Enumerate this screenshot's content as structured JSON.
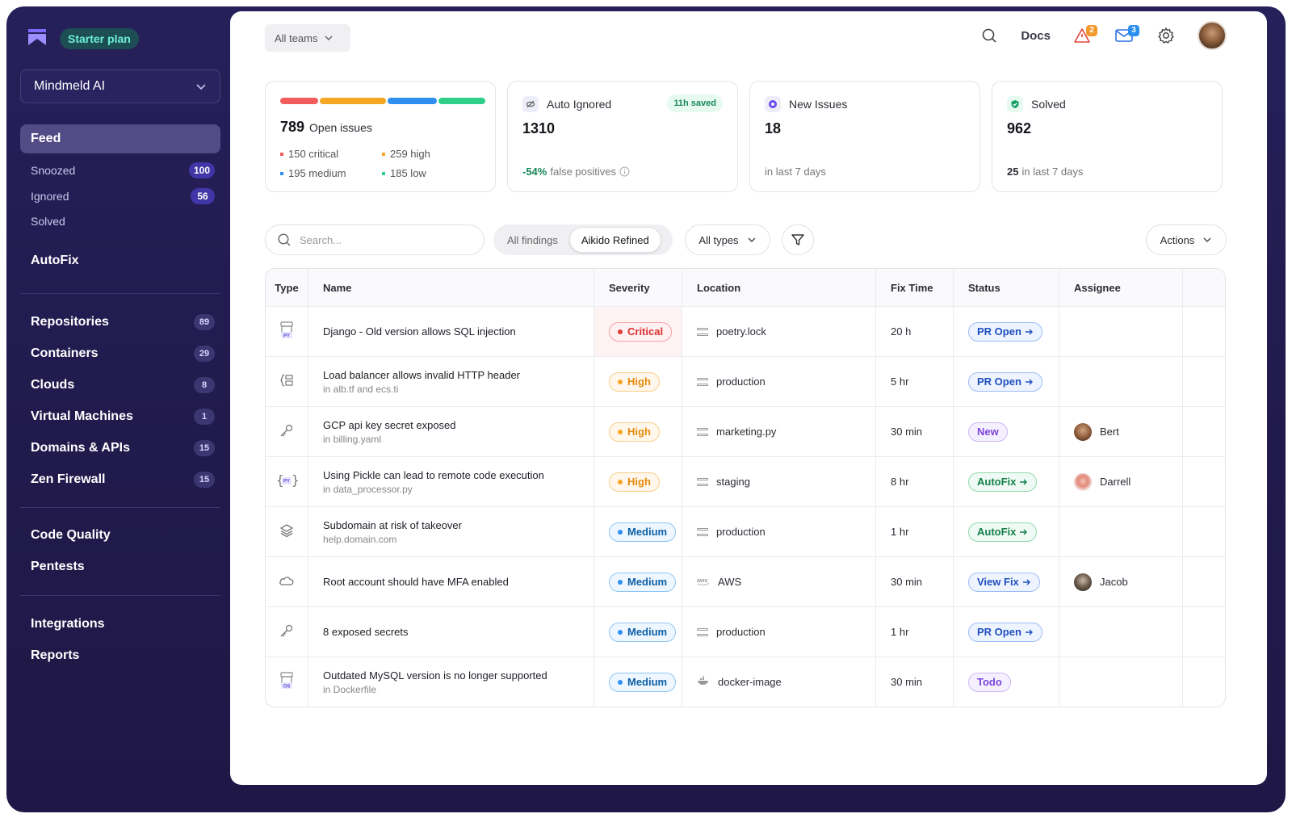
{
  "sidebar": {
    "plan_badge": "Starter plan",
    "org_name": "Mindmeld AI",
    "feed_label": "Feed",
    "sub_items": [
      {
        "label": "Snoozed",
        "count": "100"
      },
      {
        "label": "Ignored",
        "count": "56"
      },
      {
        "label": "Solved",
        "count": ""
      }
    ],
    "autofix_label": "AutoFix",
    "groups": [
      {
        "label": "Repositories",
        "count": "89"
      },
      {
        "label": "Containers",
        "count": "29"
      },
      {
        "label": "Clouds",
        "count": "8"
      },
      {
        "label": "Virtual Machines",
        "count": "1"
      },
      {
        "label": "Domains & APIs",
        "count": "15"
      },
      {
        "label": "Zen Firewall",
        "count": "15"
      }
    ],
    "code_quality_label": "Code Quality",
    "pentests_label": "Pentests",
    "integrations_label": "Integrations",
    "reports_label": "Reports"
  },
  "header": {
    "teams_select": "All teams",
    "docs_label": "Docs",
    "alerts_count": "2",
    "inbox_count": "3"
  },
  "stats": {
    "open": {
      "count": "789",
      "label": "Open issues",
      "critical": "150 critical",
      "high": "259 high",
      "medium": "195 medium",
      "low": "185 low",
      "distribution": [
        150,
        259,
        195,
        185
      ]
    },
    "auto_ignored": {
      "title": "Auto Ignored",
      "badge": "11h saved",
      "value": "1310",
      "sub_value": "-54%",
      "sub_text": "false positives"
    },
    "new_issues": {
      "title": "New Issues",
      "value": "18",
      "sub_text": "in last 7 days"
    },
    "solved": {
      "title": "Solved",
      "value": "962",
      "sub_value": "25",
      "sub_text": "in last 7 days"
    }
  },
  "toolbar": {
    "search_placeholder": "Search...",
    "seg_all": "All findings",
    "seg_refined": "Aikido Refined",
    "types_select": "All types",
    "actions_label": "Actions"
  },
  "table": {
    "headers": {
      "type": "Type",
      "name": "Name",
      "severity": "Severity",
      "location": "Location",
      "fix_time": "Fix Time",
      "status": "Status",
      "assignee": "Assignee"
    },
    "rows": [
      {
        "type_icon": "python-package-icon",
        "name": "Django - Old version allows SQL injection",
        "sub": "",
        "severity": "Critical",
        "location": "poetry.lock",
        "loc_icon": "server-icon",
        "fix_time": "20 h",
        "status": "PR Open",
        "assignee": ""
      },
      {
        "type_icon": "iac-file-icon",
        "name": "Load balancer allows invalid HTTP header",
        "sub": "in alb.tf and ecs.ti",
        "severity": "High",
        "location": "production",
        "loc_icon": "server-icon",
        "fix_time": "5 hr",
        "status": "PR Open",
        "assignee": ""
      },
      {
        "type_icon": "key-icon",
        "name": "GCP api key secret exposed",
        "sub": "in billing.yaml",
        "severity": "High",
        "location": "marketing.py",
        "loc_icon": "server-icon",
        "fix_time": "30 min",
        "status": "New",
        "assignee": "Bert"
      },
      {
        "type_icon": "python-code-icon",
        "name": "Using Pickle can lead to remote code execution",
        "sub": "in data_processor.py",
        "severity": "High",
        "location": "staging",
        "loc_icon": "server-icon",
        "fix_time": "8 hr",
        "status": "AutoFix",
        "assignee": "Darrell"
      },
      {
        "type_icon": "layers-icon",
        "name": "Subdomain at risk of takeover",
        "sub": "help.domain.com",
        "severity": "Medium",
        "location": "production",
        "loc_icon": "server-icon",
        "fix_time": "1 hr",
        "status": "AutoFix",
        "assignee": ""
      },
      {
        "type_icon": "cloud-icon",
        "name": "Root account should have MFA enabled",
        "sub": "",
        "severity": "Medium",
        "location": "AWS",
        "loc_icon": "aws-icon",
        "fix_time": "30 min",
        "status": "View Fix",
        "assignee": "Jacob"
      },
      {
        "type_icon": "key-icon",
        "name": "8 exposed secrets",
        "sub": "",
        "severity": "Medium",
        "location": "production",
        "loc_icon": "server-icon",
        "fix_time": "1 hr",
        "status": "PR Open",
        "assignee": ""
      },
      {
        "type_icon": "os-package-icon",
        "name": "Outdated MySQL version is no longer supported",
        "sub": "in Dockerfile",
        "severity": "Medium",
        "location": "docker-image",
        "loc_icon": "docker-icon",
        "fix_time": "30 min",
        "status": "Todo",
        "assignee": ""
      }
    ]
  },
  "colors": {
    "critical": "#f25c5c",
    "high": "#f5a623",
    "medium": "#2f8ff0",
    "low": "#2fcf8a",
    "sidebar_bg": "#221b4e",
    "plan_badge": "#6ff0d8"
  }
}
